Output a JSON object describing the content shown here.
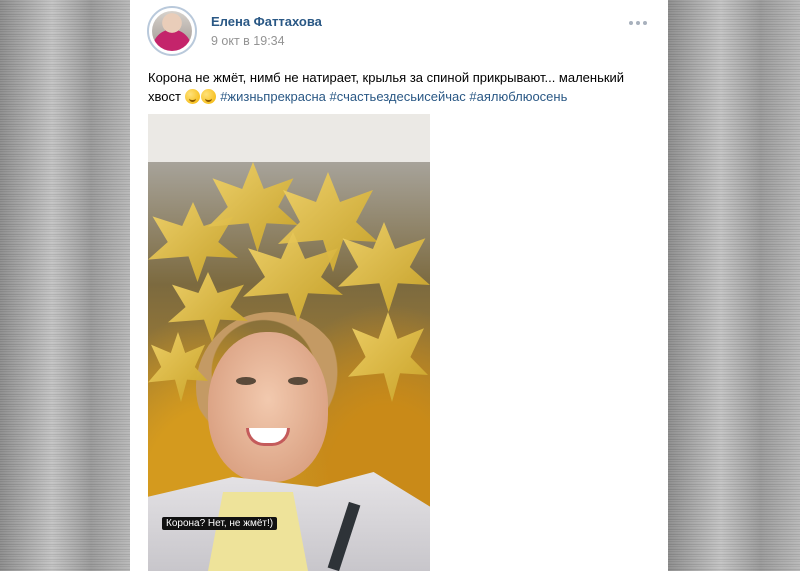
{
  "post": {
    "author": "Елена Фаттахова",
    "date": "9 окт в 19:34",
    "text": "Корона не жмёт, нимб не натирает, крылья за спиной прикрывают... маленький хвост",
    "emojis": [
      "smirk-emoji",
      "grinning-squint-emoji"
    ],
    "hashtags": [
      "#жизньпрекрасна",
      "#счастьездесьисейчас",
      "#аялюблюосень"
    ],
    "photo_caption": "Корона? Нет, не жмёт!)"
  },
  "colors": {
    "link": "#2a5885",
    "meta": "#939393"
  }
}
